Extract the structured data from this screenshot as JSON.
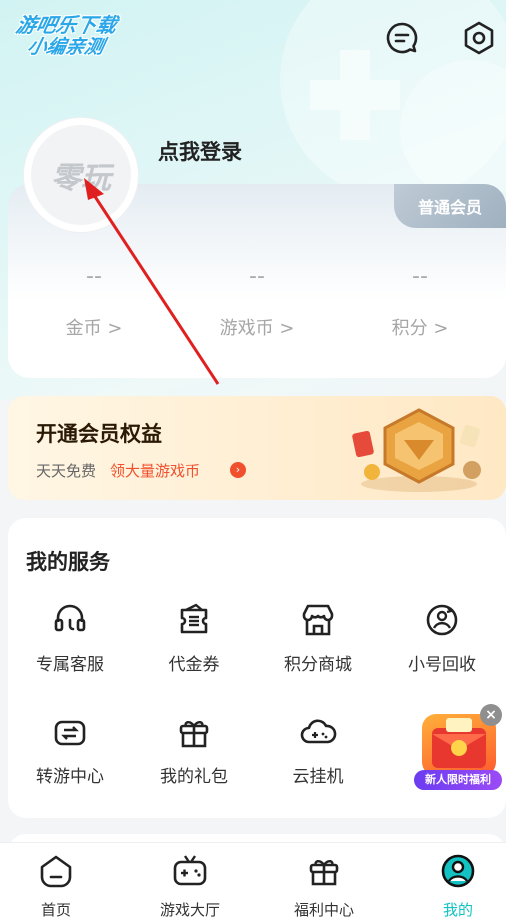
{
  "watermark": {
    "line1": "游吧乐下载",
    "line2": "小编亲测"
  },
  "header": {
    "login_text": "点我登录",
    "avatar_text": "零玩"
  },
  "member_card": {
    "badge": "普通会员",
    "stats": [
      {
        "value": "--",
        "label": "金币 >"
      },
      {
        "value": "--",
        "label": "游戏币 >"
      },
      {
        "value": "--",
        "label": "积分 >"
      }
    ]
  },
  "vip": {
    "title": "开通会员权益",
    "subtitle": "天天免费",
    "link": "领大量游戏币"
  },
  "services": {
    "title": "我的服务",
    "items": [
      {
        "label": "专属客服",
        "icon": "headset-icon"
      },
      {
        "label": "代金券",
        "icon": "voucher-icon"
      },
      {
        "label": "积分商城",
        "icon": "store-icon"
      },
      {
        "label": "小号回收",
        "icon": "recycle-user-icon"
      },
      {
        "label": "转游中心",
        "icon": "transfer-game-icon"
      },
      {
        "label": "我的礼包",
        "icon": "gift-icon"
      },
      {
        "label": "云挂机",
        "icon": "cloud-game-icon"
      }
    ]
  },
  "promo": {
    "label": "新人限时福利"
  },
  "tabbar": {
    "tabs": [
      {
        "label": "首页",
        "icon": "home-icon"
      },
      {
        "label": "游戏大厅",
        "icon": "gamepad-icon"
      },
      {
        "label": "福利中心",
        "icon": "gift-icon"
      },
      {
        "label": "我的",
        "icon": "profile-icon",
        "active": true
      }
    ]
  },
  "colors": {
    "accent": "#13c2c2",
    "vip_link": "#f0502d",
    "annotation_arrow": "#e02020"
  }
}
